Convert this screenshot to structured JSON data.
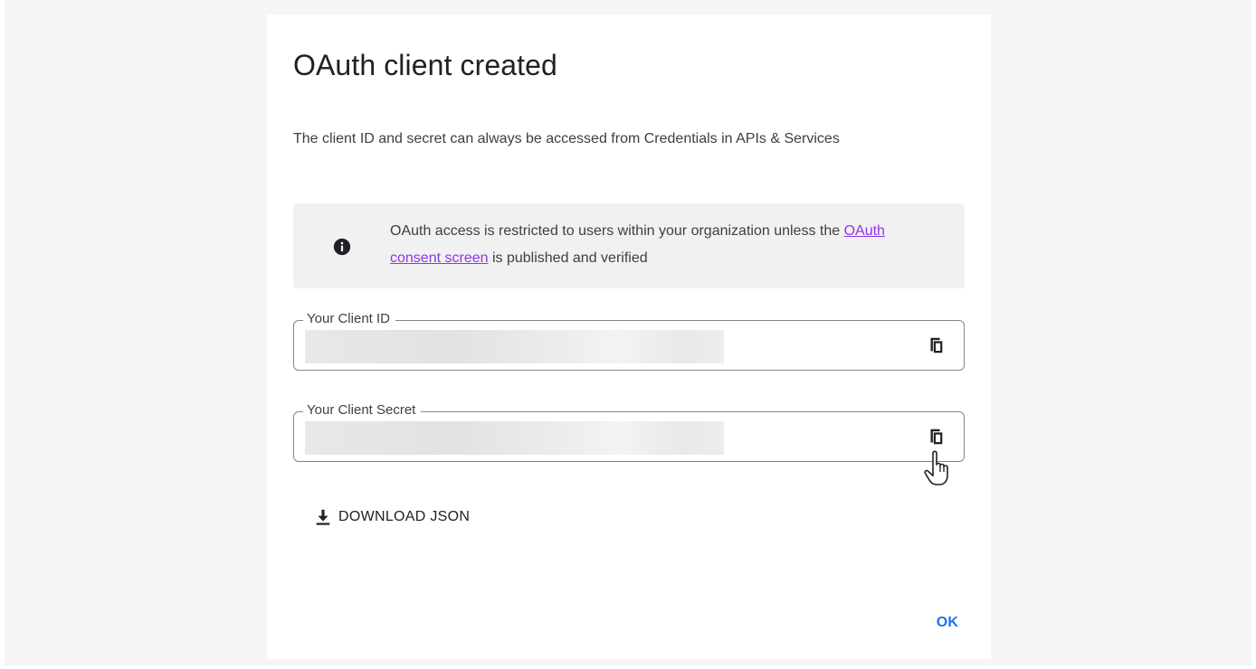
{
  "dialog": {
    "title": "OAuth client created",
    "description": "The client ID and secret can always be accessed from Credentials in APIs & Services",
    "info": {
      "text_before": "OAuth access is restricted to users within your organization unless the ",
      "link_label": "OAuth consent screen",
      "text_after": " is published and verified",
      "icon": "info-icon"
    },
    "client_id": {
      "label": "Your Client ID",
      "value": "",
      "copy_icon": "copy-icon"
    },
    "client_secret": {
      "label": "Your Client Secret",
      "value": "",
      "copy_icon": "copy-icon"
    },
    "download": {
      "label": "DOWNLOAD JSON",
      "icon": "download-icon"
    },
    "ok_label": "OK"
  },
  "colors": {
    "accent": "#1a73e8",
    "link": "#9334e6",
    "info_background": "#f1f1f1"
  }
}
